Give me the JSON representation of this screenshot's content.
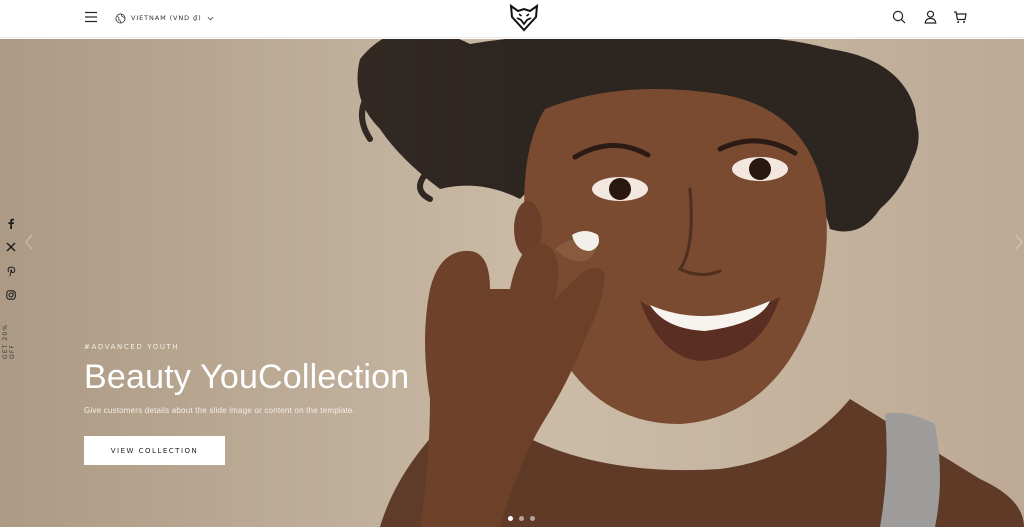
{
  "header": {
    "locale_label": "VIETNAM (VND ₫)",
    "icons": [
      "menu-icon",
      "globe-icon",
      "chevron-down-icon",
      "fox-logo",
      "search-icon",
      "account-icon",
      "cart-icon"
    ]
  },
  "social": {
    "icons": [
      "facebook-icon",
      "x-icon",
      "pinterest-icon",
      "instagram-icon"
    ],
    "promo_label": "GET 20% OFF"
  },
  "hero": {
    "eyebrow": "#ADVANCED YOUTH",
    "title": "Beauty YouCollection",
    "description": "Give customers details about the slide image or content on the template.",
    "cta_label": "VIEW COLLECTION",
    "slides_total": 3,
    "active_slide": 1
  },
  "colors": {
    "hero_background": "#c3b29d",
    "header_background": "#ffffff",
    "text_dark": "#1a1a1a",
    "text_light": "#ffffff"
  }
}
